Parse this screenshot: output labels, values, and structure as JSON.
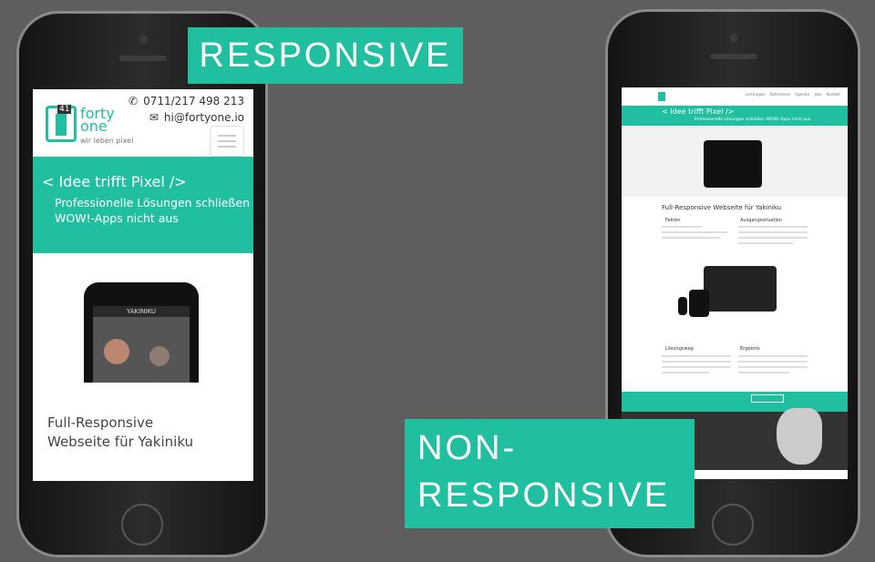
{
  "labels": {
    "responsive": "RESPONSIVE",
    "non_line1": "NON-",
    "non_line2": "RESPONSIVE"
  },
  "left_site": {
    "phone": "0711/217 498 213",
    "email": "hi@fortyone.io",
    "logo_number": "41",
    "brand_line1": "forty",
    "brand_line2": "one",
    "tagline": "wir leben pixel",
    "hero_title": "< Idee trifft Pixel />",
    "hero_subtitle": "Professionelle Lösungen schließen WOW!-Apps nicht aus",
    "device_brand": "YAKINIKU",
    "page_title_line1": "Full-Responsive",
    "page_title_line2": "Webseite für Yakiniku"
  },
  "right_site": {
    "hero_title": "< Idee trifft Pixel />",
    "hero_subtitle": "Professionelle Lösungen schließen WOW!-Apps nicht aus",
    "page_title": "Full-Responsive Webseite für Yakiniku",
    "nav": [
      "Leistungen",
      "Referenzen",
      "Agentur",
      "Jobs",
      "Kontakt"
    ],
    "sections": [
      "Fakten",
      "Ausgangssituation",
      "Lösungsweg",
      "Ergebnis"
    ]
  },
  "colors": {
    "accent": "#20bf9f",
    "background": "#5e5e5e"
  }
}
